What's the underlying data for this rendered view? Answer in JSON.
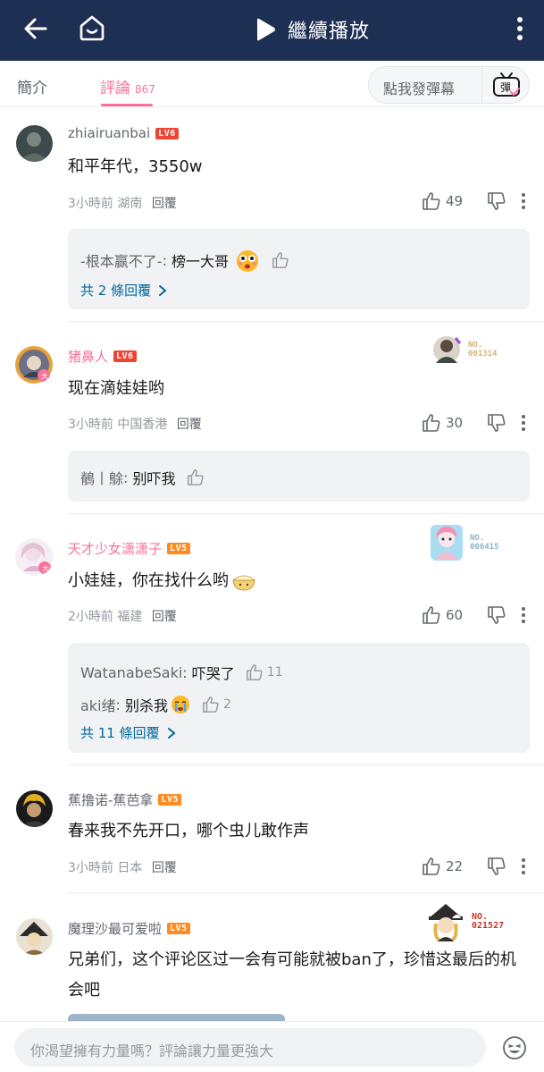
{
  "topbar": {
    "play_label": "繼續播放"
  },
  "tabs": {
    "intro": "簡介",
    "comments": "評論",
    "comments_count": "867",
    "danmu_placeholder": "點我發彈幕",
    "danmu_icon_text": "彈"
  },
  "comments": [
    {
      "user": "zhiairuanbai",
      "user_color": "#61666d",
      "level": "LV6",
      "text": "和平年代，3550w",
      "time": "3小時前 湖南",
      "reply_label": "回覆",
      "likes": "49",
      "replies": [
        {
          "user": "-根本赢不了-",
          "text": "榜一大哥",
          "likes": ""
        }
      ],
      "more_replies": "共 2 條回覆"
    },
    {
      "user": "猪鼻人",
      "user_color": "#fb7299",
      "level": "LV6",
      "badge_no": "NO.\n001314",
      "text": "现在滴娃娃哟",
      "time": "3小時前 中国香港",
      "reply_label": "回覆",
      "likes": "30",
      "replies": [
        {
          "user": "鶺丨鵌",
          "text": "别吓我",
          "likes": ""
        }
      ]
    },
    {
      "user": "天才少女潇潇子",
      "user_color": "#fb7299",
      "level": "LV5",
      "badge_no": "NO.\n006415",
      "text": "小娃娃，你在找什么哟",
      "time": "2小時前 福建",
      "reply_label": "回覆",
      "likes": "60",
      "replies": [
        {
          "user": "WatanabeSaki",
          "text": "吓哭了",
          "likes": "11"
        },
        {
          "user": "aki绪",
          "text": "别杀我",
          "likes": "2"
        }
      ],
      "more_replies": "共 11 條回覆"
    },
    {
      "user": "蕉撸诺-蕉芭拿",
      "user_color": "#61666d",
      "level": "LV5",
      "text": "春来我不先开口，哪个虫儿敢作声",
      "time": "3小時前 日本",
      "reply_label": "回覆",
      "likes": "22"
    },
    {
      "user": "魔理沙最可爱啦",
      "user_color": "#61666d",
      "level": "LV5",
      "badge_no": "NO.\n021527",
      "text": "兄弟们，这个评论区过一会有可能就被ban了，珍惜这最后的机会吧"
    }
  ],
  "bottom": {
    "placeholder": "你渴望擁有力量嗎？評論讓力量更強大"
  },
  "colors": {
    "topbar": "#1e2f54",
    "accent_pink": "#fb7299",
    "link_blue": "#00699d"
  }
}
